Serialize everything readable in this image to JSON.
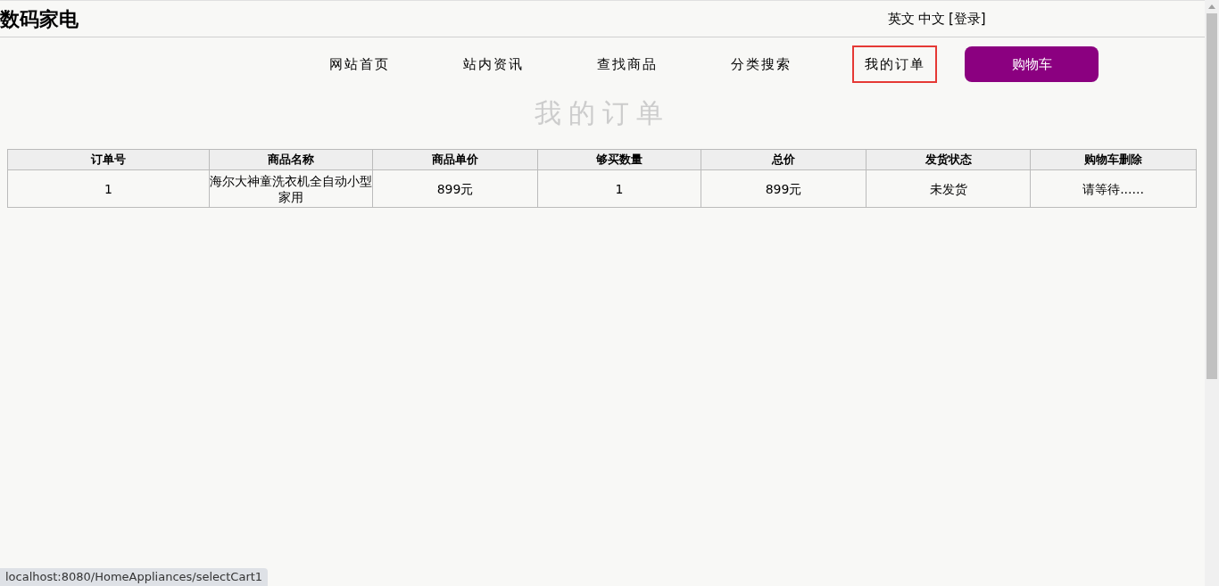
{
  "header": {
    "title": "数码家电",
    "links": [
      {
        "label": "英文"
      },
      {
        "label": "中文"
      },
      {
        "label": "[登录]"
      }
    ]
  },
  "nav": [
    {
      "label": "网站首页",
      "kind": "link",
      "selected": false
    },
    {
      "label": "站内资讯",
      "kind": "link",
      "selected": false
    },
    {
      "label": "查找商品",
      "kind": "link",
      "selected": false
    },
    {
      "label": "分类搜索",
      "kind": "link",
      "selected": false
    },
    {
      "label": "我的订单",
      "kind": "link",
      "selected": true
    },
    {
      "label": "购物车",
      "kind": "button",
      "selected": false
    }
  ],
  "page_heading": "我的订单",
  "table": {
    "columns": [
      "订单号",
      "商品名称",
      "商品单价",
      "够买数量",
      "总价",
      "发货状态",
      "购物车删除"
    ],
    "rows": [
      [
        "1",
        "海尔大神童洗衣机全自动小型家用",
        "899元",
        "1",
        "899元",
        "未发货",
        "请等待......"
      ]
    ]
  },
  "status_bar": "localhost:8080/HomeAppliances/selectCart1"
}
